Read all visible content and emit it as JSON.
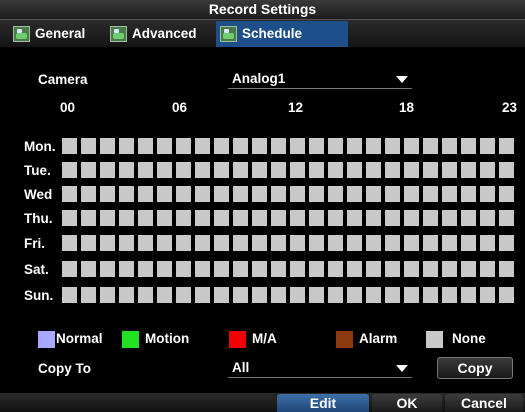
{
  "window": {
    "title": "Record Settings"
  },
  "tabs": [
    {
      "label": "General",
      "icon": "monitor-icon",
      "active": false
    },
    {
      "label": "Advanced",
      "icon": "monitor-icon",
      "active": false
    },
    {
      "label": "Schedule",
      "icon": "monitor-icon",
      "active": true
    }
  ],
  "camera": {
    "label": "Camera",
    "value": "Analog1"
  },
  "hours": [
    "00",
    "06",
    "12",
    "18",
    "23"
  ],
  "days": [
    "Mon.",
    "Tue.",
    "Wed",
    "Thu.",
    "Fri.",
    "Sat.",
    "Sun."
  ],
  "schedule": {
    "slots_per_day": 24,
    "default_state": "None"
  },
  "legend": [
    {
      "label": "Normal",
      "color": "#a9a9ff"
    },
    {
      "label": "Motion",
      "color": "#22e022"
    },
    {
      "label": "M/A",
      "color": "#f00000"
    },
    {
      "label": "Alarm",
      "color": "#8b3a0f"
    },
    {
      "label": "None",
      "color": "#c8c8c8"
    }
  ],
  "copy": {
    "label": "Copy To",
    "value": "All",
    "button": "Copy"
  },
  "footer": {
    "edit": "Edit",
    "ok": "OK",
    "cancel": "Cancel"
  }
}
